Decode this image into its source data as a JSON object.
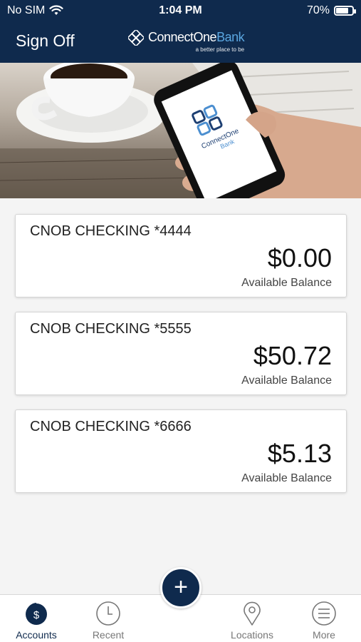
{
  "status_bar": {
    "carrier": "No SIM",
    "time": "1:04 PM",
    "battery": "70%"
  },
  "nav": {
    "sign_off": "Sign Off",
    "brand_name_primary": "ConnectOne",
    "brand_name_secondary": "Bank",
    "brand_tagline": "a better place to be"
  },
  "hero": {
    "phone_logo_primary": "ConnectOne",
    "phone_logo_secondary": "Bank"
  },
  "accounts": [
    {
      "name": "CNOB CHECKING *4444",
      "balance": "$0.00",
      "balance_label": "Available Balance"
    },
    {
      "name": "CNOB CHECKING *5555",
      "balance": "$50.72",
      "balance_label": "Available Balance"
    },
    {
      "name": "CNOB CHECKING *6666",
      "balance": "$5.13",
      "balance_label": "Available Balance"
    }
  ],
  "tabs": [
    {
      "label": "Accounts",
      "icon": "accounts-dollar-icon",
      "active": true
    },
    {
      "label": "Recent",
      "icon": "clock-icon",
      "active": false
    },
    {
      "label": "Locations",
      "icon": "map-pin-icon",
      "active": false
    },
    {
      "label": "More",
      "icon": "menu-icon",
      "active": false
    }
  ],
  "fab": {
    "symbol": "+",
    "icon": "plus-icon"
  },
  "colors": {
    "navy": "#0f2a4d",
    "accent": "#5aa6e0",
    "background": "#f4f4f4"
  }
}
